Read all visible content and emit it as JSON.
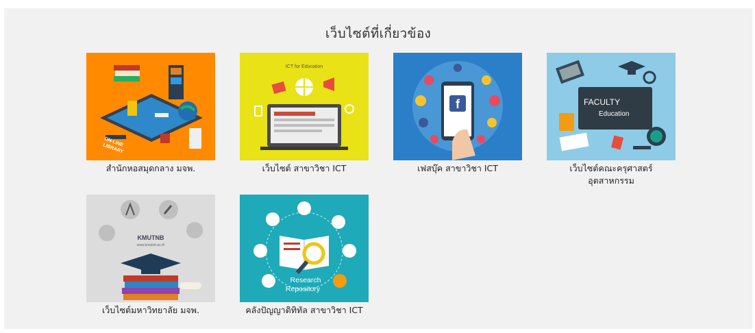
{
  "section": {
    "title": "เว็บไซต์ที่เกี่ยวข้อง"
  },
  "links": [
    {
      "id": "library",
      "label": "สำนักหอสมุดกลาง มจพ.",
      "image_text": [
        "ON-LINE",
        "LIBRARY"
      ],
      "icon": "online-library-illustration"
    },
    {
      "id": "ict-site",
      "label": "เว็บไซต์ สาขาวิชา ICT",
      "image_text": [
        "ICT for Education"
      ],
      "icon": "ict-education-illustration"
    },
    {
      "id": "facebook",
      "label": "เฟสบุ๊ค สาขาวิชา ICT",
      "image_text": [
        "f"
      ],
      "icon": "facebook-phone-illustration"
    },
    {
      "id": "faculty",
      "label": "เว็บไซต์คณะครุศาสตร์อุตสาหกรรม",
      "image_text": [
        "FACULTY",
        "Education"
      ],
      "icon": "faculty-education-illustration"
    },
    {
      "id": "kmutnb",
      "label": "เว็บไซต์มหาวิทยาลัย มจพ.",
      "image_text": [
        "KMUTNB",
        "www.kmutnb.ac.th"
      ],
      "icon": "graduation-cap-illustration"
    },
    {
      "id": "repository",
      "label": "คลังปัญญาดิทิทัล สาขาวิชา ICT",
      "image_text": [
        "Research",
        "Repository"
      ],
      "icon": "research-repository-illustration"
    }
  ],
  "colors": {
    "panel_bg": "#f1f1f1",
    "library_bg": "#ff8a00",
    "ict_bg": "#e8e216",
    "facebook_bg": "#2b7fc8",
    "faculty_bg": "#8ecbe6",
    "kmutnb_bg": "#dcdcdc",
    "repository_bg": "#1eaab8"
  }
}
